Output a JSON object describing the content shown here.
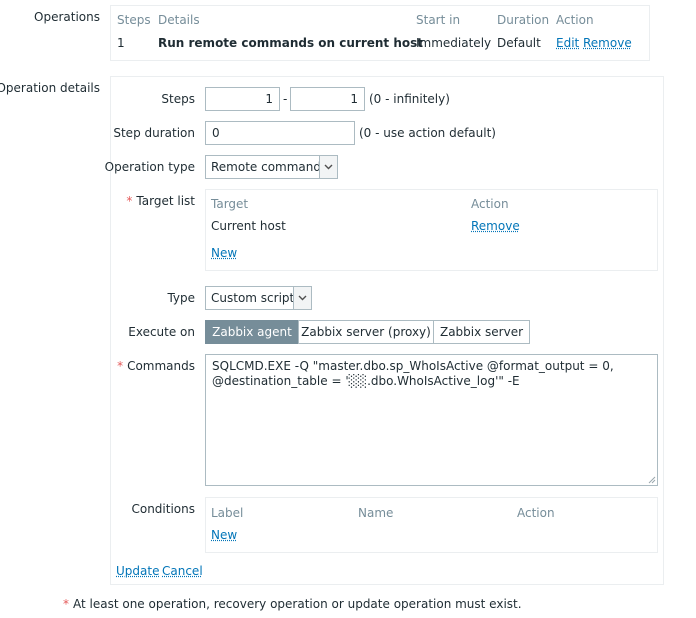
{
  "operations": {
    "label": "Operations",
    "headers": {
      "steps": "Steps",
      "details": "Details",
      "start_in": "Start in",
      "duration": "Duration",
      "action": "Action"
    },
    "row": {
      "steps": "1",
      "details": "Run remote commands on current host",
      "start_in": "Immediately",
      "duration": "Default",
      "edit": "Edit",
      "remove": "Remove"
    }
  },
  "details": {
    "label": "Operation details",
    "steps": {
      "label": "Steps",
      "from": "1",
      "separator": "-",
      "to": "1",
      "hint": "(0 - infinitely)"
    },
    "step_duration": {
      "label": "Step duration",
      "value": "0",
      "hint": "(0 - use action default)"
    },
    "operation_type": {
      "label": "Operation type",
      "value": "Remote command"
    },
    "target_list": {
      "label": "Target list",
      "headers": {
        "target": "Target",
        "action": "Action"
      },
      "row": {
        "target": "Current host",
        "remove": "Remove"
      },
      "new": "New"
    },
    "type": {
      "label": "Type",
      "value": "Custom script"
    },
    "execute_on": {
      "label": "Execute on",
      "options": [
        "Zabbix agent",
        "Zabbix server (proxy)",
        "Zabbix server"
      ],
      "selected": "Zabbix agent"
    },
    "commands": {
      "label": "Commands",
      "value": "SQLCMD.EXE -Q \"master.dbo.sp_WhoIsActive @format_output = 0, @destination_table = '░░.dbo.WhoIsActive_log'\" -E"
    },
    "conditions": {
      "label": "Conditions",
      "headers": {
        "label": "Label",
        "name": "Name",
        "action": "Action"
      },
      "new": "New"
    },
    "buttons": {
      "update": "Update",
      "cancel": "Cancel"
    }
  },
  "footer_note": "At least one operation, recovery operation or update operation must exist.",
  "required_marker": "*",
  "colors": {
    "link": "#0275b8",
    "header": "#768d99",
    "required": "#e45959",
    "active_segment": "#768d99",
    "border": "#acbbc2"
  },
  "icons": {
    "dropdown": "chevron-down-icon",
    "resize": "resize-grip-icon"
  }
}
